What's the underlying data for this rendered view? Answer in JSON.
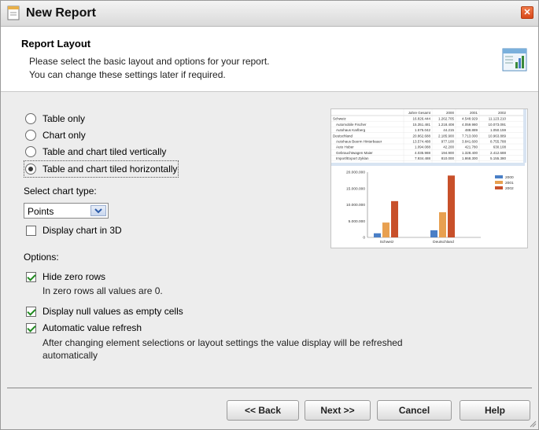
{
  "window": {
    "title": "New Report"
  },
  "header": {
    "title": "Report Layout",
    "line1": "Please select the basic layout and options for your report.",
    "line2": "You can change these settings later if required."
  },
  "layout_options": [
    {
      "label": "Table only",
      "selected": false
    },
    {
      "label": "Chart only",
      "selected": false
    },
    {
      "label": "Table and chart tiled vertically",
      "selected": false
    },
    {
      "label": "Table and chart tiled horizontally",
      "selected": true
    }
  ],
  "chart_type": {
    "label": "Select chart type:",
    "value": "Points",
    "display_3d_label": "Display chart in 3D",
    "display_3d_checked": false
  },
  "options": {
    "label": "Options:",
    "hide_zero_rows": {
      "label": "Hide zero rows",
      "checked": true,
      "note": "In zero rows all values are 0."
    },
    "null_empty": {
      "label": "Display null values as empty cells",
      "checked": true
    },
    "auto_refresh": {
      "label": "Automatic value refresh",
      "checked": true,
      "note_line1": "After changing element selections or layout settings the value display will be refreshed",
      "note_line2": "automatically"
    }
  },
  "preview": {
    "table": {
      "headers": [
        "",
        "Jahre Gesamt",
        "2000",
        "2001",
        "2002"
      ],
      "rows": [
        [
          "Schweiz",
          "16.826.444",
          "1.262.705",
          "4.548.929",
          "11.123.210"
        ],
        [
          "Automobile Fischer",
          "15.351.481",
          "1.218.408",
          "4.059.980",
          "10.073.091"
        ],
        [
          "Autohaus Karlberg",
          "1.575.042",
          "44.215",
          "488.889",
          "1.050.159"
        ],
        [
          "Deutschland",
          "20.862.688",
          "2.185.900",
          "7.713.000",
          "10.963.889"
        ],
        [
          "Autohaus Beerm Hinterbauer",
          "13.574.488",
          "977.100",
          "3.841.600",
          "8.755.788"
        ],
        [
          "Auto Huber",
          "1.094.088",
          "42.200",
          "421.780",
          "630.108"
        ],
        [
          "Gebrauchtwagen Maier",
          "4.035.988",
          "194.900",
          "1.328.400",
          "2.412.688"
        ],
        [
          "Import/Export Zyklan",
          "7.934.488",
          "810.000",
          "1.868.300",
          "5.155.380"
        ]
      ]
    },
    "chart_data": {
      "type": "bar",
      "categories": [
        "Schweiz",
        "Deutschland"
      ],
      "series": [
        {
          "name": "2000",
          "values": [
            1262705,
            2185900
          ],
          "color": "#4a7fc6"
        },
        {
          "name": "2001",
          "values": [
            4548929,
            7713000
          ],
          "color": "#e8a050"
        },
        {
          "name": "2002",
          "values": [
            11123210,
            18963889
          ],
          "color": "#c8502a"
        }
      ],
      "yticks": [
        "20.000.000",
        "15.000.000",
        "10.000.000",
        "5.000.000",
        "0"
      ],
      "ylim": [
        0,
        20000000
      ]
    }
  },
  "buttons": {
    "back": "<< Back",
    "next": "Next >>",
    "cancel": "Cancel",
    "help": "Help"
  }
}
